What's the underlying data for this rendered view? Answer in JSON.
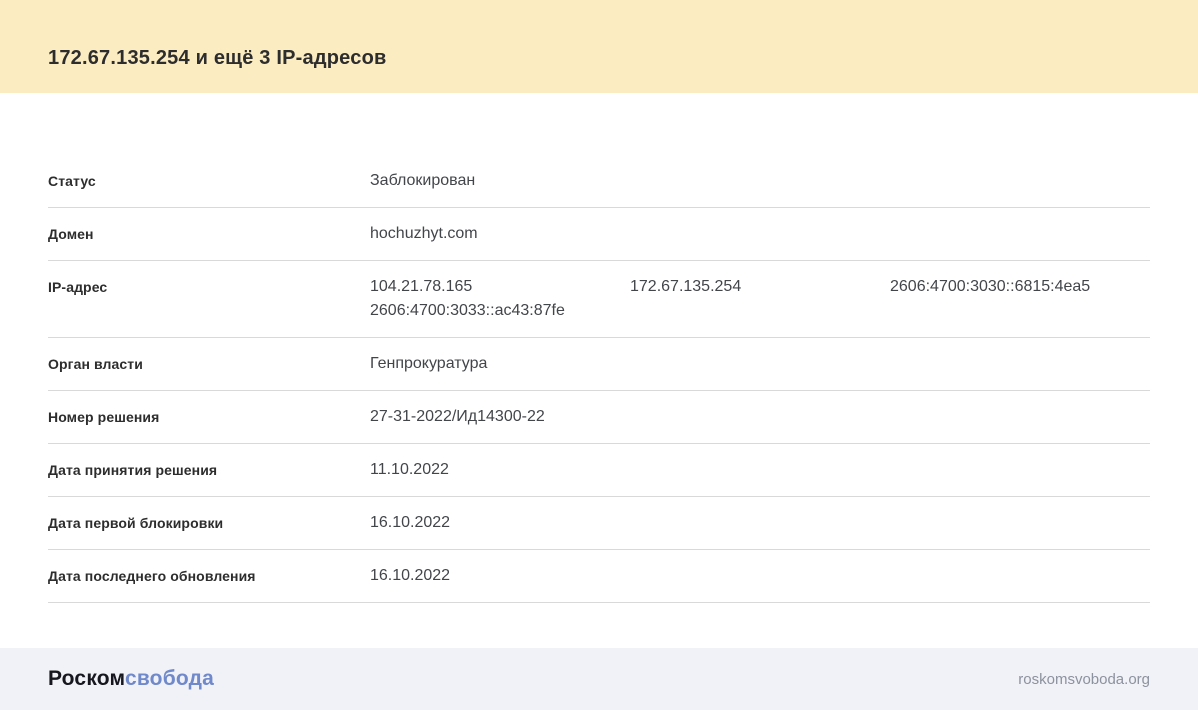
{
  "header": {
    "title": "172.67.135.254 и ещё 3 IP-адресов"
  },
  "table": {
    "rows": [
      {
        "label": "Статус",
        "values": [
          [
            "Заблокирован"
          ]
        ]
      },
      {
        "label": "Домен",
        "values": [
          [
            "hochuzhyt.com"
          ]
        ]
      },
      {
        "label": "IP-адрес",
        "values": [
          [
            "104.21.78.165",
            "2606:4700:3033::ac43:87fe"
          ],
          [
            "172.67.135.254"
          ],
          [
            "2606:4700:3030::6815:4ea5"
          ]
        ]
      },
      {
        "label": "Орган власти",
        "values": [
          [
            "Генпрокуратура"
          ]
        ]
      },
      {
        "label": "Номер решения",
        "values": [
          [
            "27-31-2022/Ид14300-22"
          ]
        ]
      },
      {
        "label": "Дата принятия решения",
        "values": [
          [
            "11.10.2022"
          ]
        ]
      },
      {
        "label": "Дата первой блокировки",
        "values": [
          [
            "16.10.2022"
          ]
        ]
      },
      {
        "label": "Дата последнего обновления",
        "values": [
          [
            "16.10.2022"
          ]
        ]
      }
    ]
  },
  "footer": {
    "logo_part1": "Роском",
    "logo_part2": "свобода",
    "site_url": "roskomsvoboda.org"
  },
  "colors": {
    "header_background": "#fcecc2",
    "footer_background": "#f1f2f7",
    "logo_accent_blue": "#7089ca",
    "divider": "#d9d9d9",
    "text_primary": "#2d2d2d",
    "text_value": "#42454a",
    "text_muted": "#8c929e"
  }
}
